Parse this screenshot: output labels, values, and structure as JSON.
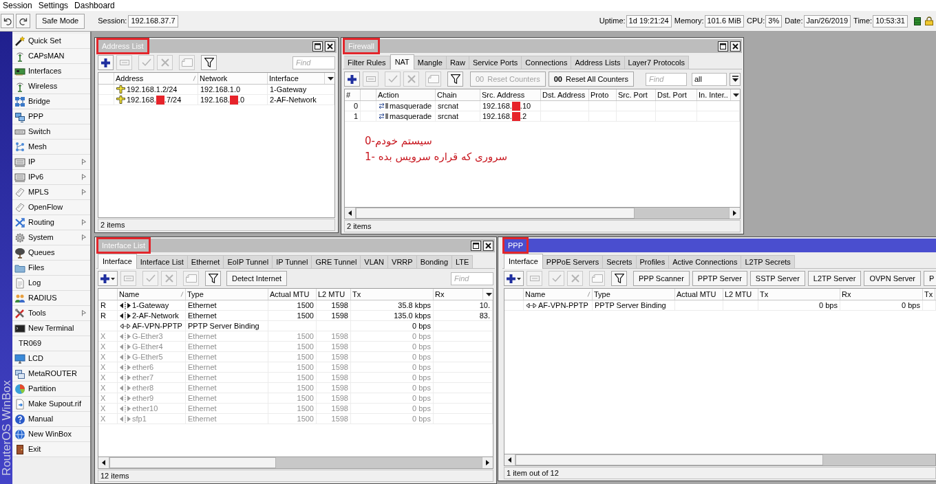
{
  "menu_bar": [
    {
      "label": "Session"
    },
    {
      "label": "Settings"
    },
    {
      "label": "Dashboard"
    }
  ],
  "toolbar": {
    "safe_mode": "Safe Mode",
    "session": {
      "label": "Session:",
      "value": "192.168.37.7"
    },
    "stats": [
      {
        "label": "Uptime:",
        "value": "1d 19:21:24"
      },
      {
        "label": "Memory:",
        "value": "101.6 MiB"
      },
      {
        "label": "CPU:",
        "value": "3%"
      },
      {
        "label": "Date:",
        "value": "Jan/26/2019"
      },
      {
        "label": "Time:",
        "value": "10:53:31"
      }
    ]
  },
  "side_banner": "RouterOS WinBox",
  "sidebar": [
    {
      "label": "Quick Set",
      "submenu": false
    },
    {
      "label": "CAPsMAN",
      "submenu": false
    },
    {
      "label": "Interfaces",
      "submenu": false
    },
    {
      "label": "Wireless",
      "submenu": false
    },
    {
      "label": "Bridge",
      "submenu": false
    },
    {
      "label": "PPP",
      "submenu": false
    },
    {
      "label": "Switch",
      "submenu": false
    },
    {
      "label": "Mesh",
      "submenu": false
    },
    {
      "label": "IP",
      "submenu": true
    },
    {
      "label": "IPv6",
      "submenu": true
    },
    {
      "label": "MPLS",
      "submenu": true
    },
    {
      "label": "OpenFlow",
      "submenu": false
    },
    {
      "label": "Routing",
      "submenu": true
    },
    {
      "label": "System",
      "submenu": true
    },
    {
      "label": "Queues",
      "submenu": false
    },
    {
      "label": "Files",
      "submenu": false
    },
    {
      "label": "Log",
      "submenu": false
    },
    {
      "label": "RADIUS",
      "submenu": false
    },
    {
      "label": "Tools",
      "submenu": true
    },
    {
      "label": "New Terminal",
      "submenu": false
    },
    {
      "label": "TR069",
      "submenu": false
    },
    {
      "label": "LCD",
      "submenu": false
    },
    {
      "label": "MetaROUTER",
      "submenu": false
    },
    {
      "label": "Partition",
      "submenu": false
    },
    {
      "label": "Make Supout.rif",
      "submenu": false
    },
    {
      "label": "Manual",
      "submenu": false
    },
    {
      "label": "New WinBox",
      "submenu": false
    },
    {
      "label": "Exit",
      "submenu": false
    }
  ],
  "address_list_window": {
    "title": "Address List",
    "active": false,
    "highlighted": true,
    "tools": [
      {
        "kind": "add",
        "disabled": false
      },
      {
        "kind": "remove",
        "disabled": true
      },
      {
        "kind": "enable",
        "disabled": true
      },
      {
        "kind": "disable",
        "disabled": true
      },
      {
        "kind": "comment",
        "disabled": true
      },
      {
        "kind": "filter",
        "disabled": false
      }
    ],
    "find": {
      "placeholder": "Find"
    },
    "table": {
      "columns": [
        {
          "label": "Address",
          "sorted": true
        },
        {
          "label": "Network",
          "sorted": false
        },
        {
          "label": "Interface",
          "sorted": false
        }
      ],
      "rows": [
        {
          "address": "192.168.1.2/24",
          "network": "192.168.1.0",
          "interface": "1-Gateway"
        },
        {
          "address": [
            "192.168.",
            ".7/24"
          ],
          "network": [
            "192.168.",
            ".0"
          ],
          "interface": "2-AF-Network"
        }
      ]
    },
    "status": "2 items"
  },
  "firewall_window": {
    "title": "Firewall",
    "active": false,
    "highlighted": true,
    "tabs": [
      {
        "label": "Filter Rules",
        "selected": false
      },
      {
        "label": "NAT",
        "selected": true
      },
      {
        "label": "Mangle",
        "selected": false
      },
      {
        "label": "Raw",
        "selected": false
      },
      {
        "label": "Service Ports",
        "selected": false
      },
      {
        "label": "Connections",
        "selected": false
      },
      {
        "label": "Address Lists",
        "selected": false
      },
      {
        "label": "Layer7 Protocols",
        "selected": false
      }
    ],
    "tools": [
      {
        "kind": "add",
        "disabled": false
      },
      {
        "kind": "remove",
        "disabled": true
      },
      {
        "kind": "enable",
        "disabled": true
      },
      {
        "kind": "disable",
        "disabled": true
      },
      {
        "kind": "comment",
        "disabled": true
      },
      {
        "kind": "filter",
        "disabled": false
      }
    ],
    "buttons": [
      {
        "counter": "00",
        "label": "Reset Counters",
        "disabled": true
      },
      {
        "counter": "00",
        "label": "Reset All Counters",
        "disabled": false
      }
    ],
    "find": {
      "placeholder": "Find"
    },
    "select": {
      "value": "all"
    },
    "table": {
      "columns": [
        {
          "label": "#",
          "sorted": false
        },
        {
          "label": "Action",
          "sorted": false
        },
        {
          "label": "Chain",
          "sorted": false
        },
        {
          "label": "Src. Address",
          "sorted": false
        },
        {
          "label": "Dst. Address",
          "sorted": false
        },
        {
          "label": "Proto",
          "sorted": false
        },
        {
          "label": "Src. Port",
          "sorted": false
        },
        {
          "label": "Dst. Port",
          "sorted": false
        },
        {
          "label": "In. Inter..",
          "sorted": false
        }
      ],
      "rows": [
        {
          "number": "0",
          "action": "masquerade",
          "chain": "srcnat",
          "src_address": [
            "192.168.",
            ".10"
          ]
        },
        {
          "number": "1",
          "action": "masquerade",
          "chain": "srcnat",
          "src_address": [
            "192.168.",
            ".2"
          ]
        }
      ]
    },
    "annotation": [
      "سیستم خودم-0",
      "سروری که قراره سرویس بده -1"
    ],
    "status": "2 items"
  },
  "interface_list_window": {
    "title": "Interface List",
    "active": false,
    "highlighted": true,
    "tabs": [
      {
        "label": "Interface",
        "selected": true
      },
      {
        "label": "Interface List",
        "selected": false
      },
      {
        "label": "Ethernet",
        "selected": false
      },
      {
        "label": "EoIP Tunnel",
        "selected": false
      },
      {
        "label": "IP Tunnel",
        "selected": false
      },
      {
        "label": "GRE Tunnel",
        "selected": false
      },
      {
        "label": "VLAN",
        "selected": false
      },
      {
        "label": "VRRP",
        "selected": false
      },
      {
        "label": "Bonding",
        "selected": false
      },
      {
        "label": "LTE",
        "selected": false
      }
    ],
    "tools": [
      {
        "kind": "add_menu",
        "disabled": false
      },
      {
        "kind": "remove",
        "disabled": true
      },
      {
        "kind": "enable",
        "disabled": true
      },
      {
        "kind": "disable",
        "disabled": true
      },
      {
        "kind": "comment",
        "disabled": true
      },
      {
        "kind": "filter",
        "disabled": false
      }
    ],
    "buttons": [
      {
        "label": "Detect Internet"
      }
    ],
    "find": {
      "placeholder": "Find"
    },
    "table": {
      "columns": [
        {
          "label": "Name",
          "sorted": true
        },
        {
          "label": "Type",
          "sorted": false
        },
        {
          "label": "Actual MTU",
          "sorted": false
        },
        {
          "label": "L2 MTU",
          "sorted": false
        },
        {
          "label": "Tx",
          "sorted": false
        },
        {
          "label": "Rx",
          "sorted": false
        }
      ],
      "rows": [
        {
          "flag": "R",
          "kind": "ethernet",
          "name": "1-Gateway",
          "type": "Ethernet",
          "actual_mtu": "1500",
          "l2_mtu": "1598",
          "tx": "35.8 kbps",
          "rx": "10.",
          "disabled": false
        },
        {
          "flag": "R",
          "kind": "ethernet",
          "name": "2-AF-Network",
          "type": "Ethernet",
          "actual_mtu": "1500",
          "l2_mtu": "1598",
          "tx": "135.0 kbps",
          "rx": "83.",
          "disabled": false
        },
        {
          "kind": "pptp",
          "name": "AF-VPN-PPTP",
          "type": "PPTP Server Binding",
          "tx": "0 bps",
          "disabled": false
        },
        {
          "flag": "X",
          "kind": "ethernet",
          "name": "G-Ether3",
          "type": "Ethernet",
          "actual_mtu": "1500",
          "l2_mtu": "1598",
          "tx": "0 bps",
          "disabled": true
        },
        {
          "flag": "X",
          "kind": "ethernet",
          "name": "G-Ether4",
          "type": "Ethernet",
          "actual_mtu": "1500",
          "l2_mtu": "1598",
          "tx": "0 bps",
          "disabled": true
        },
        {
          "flag": "X",
          "kind": "ethernet",
          "name": "G-Ether5",
          "type": "Ethernet",
          "actual_mtu": "1500",
          "l2_mtu": "1598",
          "tx": "0 bps",
          "disabled": true
        },
        {
          "flag": "X",
          "kind": "ethernet",
          "name": "ether6",
          "type": "Ethernet",
          "actual_mtu": "1500",
          "l2_mtu": "1598",
          "tx": "0 bps",
          "disabled": true
        },
        {
          "flag": "X",
          "kind": "ethernet",
          "name": "ether7",
          "type": "Ethernet",
          "actual_mtu": "1500",
          "l2_mtu": "1598",
          "tx": "0 bps",
          "disabled": true
        },
        {
          "flag": "X",
          "kind": "ethernet",
          "name": "ether8",
          "type": "Ethernet",
          "actual_mtu": "1500",
          "l2_mtu": "1598",
          "tx": "0 bps",
          "disabled": true
        },
        {
          "flag": "X",
          "kind": "ethernet",
          "name": "ether9",
          "type": "Ethernet",
          "actual_mtu": "1500",
          "l2_mtu": "1598",
          "tx": "0 bps",
          "disabled": true
        },
        {
          "flag": "X",
          "kind": "ethernet",
          "name": "ether10",
          "type": "Ethernet",
          "actual_mtu": "1500",
          "l2_mtu": "1598",
          "tx": "0 bps",
          "disabled": true
        },
        {
          "flag": "X",
          "kind": "ethernet",
          "name": "sfp1",
          "type": "Ethernet",
          "actual_mtu": "1500",
          "l2_mtu": "1598",
          "tx": "0 bps",
          "disabled": true
        }
      ]
    },
    "status": "12 items"
  },
  "ppp_window": {
    "title": "PPP",
    "active": true,
    "highlighted": true,
    "tabs": [
      {
        "label": "Interface",
        "selected": true
      },
      {
        "label": "PPPoE Servers",
        "selected": false
      },
      {
        "label": "Secrets",
        "selected": false
      },
      {
        "label": "Profiles",
        "selected": false
      },
      {
        "label": "Active Connections",
        "selected": false
      },
      {
        "label": "L2TP Secrets",
        "selected": false
      }
    ],
    "tools": [
      {
        "kind": "add_menu",
        "disabled": false
      },
      {
        "kind": "remove",
        "disabled": true
      },
      {
        "kind": "enable",
        "disabled": true
      },
      {
        "kind": "disable",
        "disabled": true
      },
      {
        "kind": "comment",
        "disabled": true
      },
      {
        "kind": "filter",
        "disabled": false
      }
    ],
    "buttons": [
      {
        "label": "PPP Scanner"
      },
      {
        "label": "PPTP Server"
      },
      {
        "label": "SSTP Server"
      },
      {
        "label": "L2TP Server"
      },
      {
        "label": "OVPN Server"
      },
      {
        "label": "P"
      }
    ],
    "table": {
      "columns": [
        {
          "label": "Name",
          "sorted": true
        },
        {
          "label": "Type",
          "sorted": false
        },
        {
          "label": "Actual MTU",
          "sorted": false
        },
        {
          "label": "L2 MTU",
          "sorted": false
        },
        {
          "label": "Tx",
          "sorted": false
        },
        {
          "label": "Rx",
          "sorted": false
        },
        {
          "label": "Tx",
          "sorted": false
        }
      ],
      "rows": [
        {
          "kind": "pptp",
          "name": "AF-VPN-PPTP",
          "type": "PPTP Server Binding",
          "tx": "0 bps",
          "rx": "0 bps"
        }
      ]
    },
    "status": "1 item out of 12"
  }
}
